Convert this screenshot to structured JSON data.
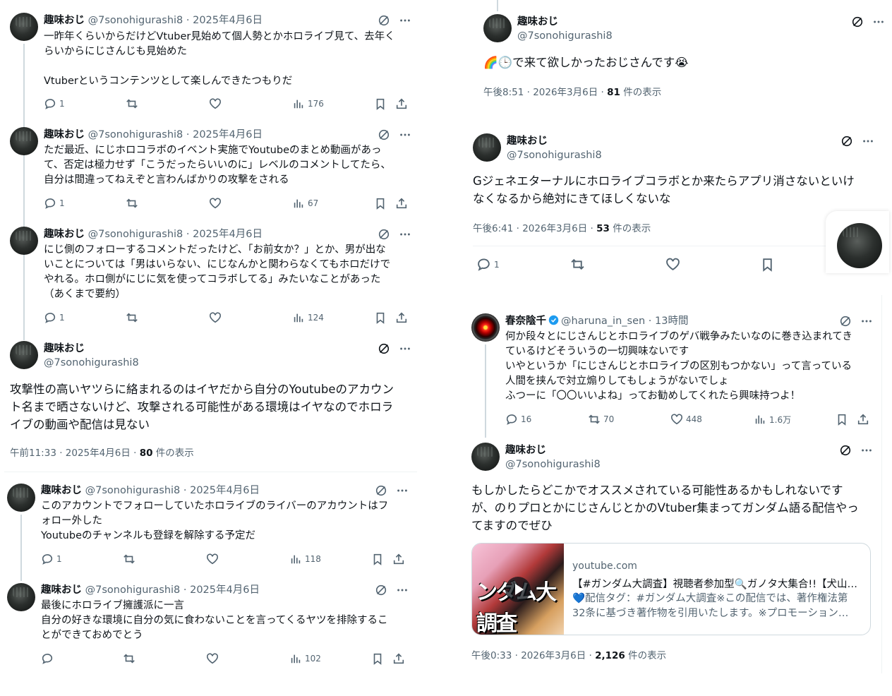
{
  "left_thread": {
    "tweets": [
      {
        "name": "趣味おじ",
        "handle": "@7sonohigurashi8",
        "date": "2025年4月6日",
        "text": "一昨年くらいからだけどVtuber見始めて個人勢とかホロライブ見て、去年く\nらいからにじさんじも見始めた\n\nVtuberというコンテンツとして楽しんできたつもりだ",
        "replies": "1",
        "retweets": "",
        "likes": "",
        "views": "176"
      },
      {
        "name": "趣味おじ",
        "handle": "@7sonohigurashi8",
        "date": "2025年4月6日",
        "text": "ただ最近、にじホロコラボのイベント実施でYoutubeのまとめ動画があっ\nて、否定は極力せず「こうだったらいいのに」レベルのコメントしてたら、\n自分は間違ってねえぞと言わんばかりの攻撃をされる",
        "replies": "1",
        "retweets": "",
        "likes": "",
        "views": "67"
      },
      {
        "name": "趣味おじ",
        "handle": "@7sonohigurashi8",
        "date": "2025年4月6日",
        "text": "にじ側のフォローするコメントだったけど、「お前女か？」とか、男が出な\nいことについては「男はいらない、にじなんかと関わらなくてもホロだけで\nやれる。ホロ側がにじに気を使ってコラボしてる」みたいなことがあった\n（あくまで要約）",
        "replies": "1",
        "retweets": "",
        "likes": "",
        "views": "124"
      }
    ],
    "main": {
      "name": "趣味おじ",
      "handle": "@7sonohigurashi8",
      "text": "攻撃性の高いヤツらに絡まれるのはイヤだから自分のYoutubeのアカウン\nト名まで晒さないけど、攻撃される可能性がある環境はイヤなのでホロラ\nイブの動画や配信は見ない",
      "time": "午前11:33 · 2025年4月6日 · ",
      "views": "80",
      "views_suffix": " 件の表示"
    },
    "replies": [
      {
        "name": "趣味おじ",
        "handle": "@7sonohigurashi8",
        "date": "2025年4月6日",
        "text": "このアカウントでフォローしていたホロライブのライバーのアカウントはフ\nォロー外した\nYoutubeのチャンネルも登録を解除する予定だ",
        "replies": "1",
        "retweets": "",
        "likes": "",
        "views": "118"
      },
      {
        "name": "趣味おじ",
        "handle": "@7sonohigurashi8",
        "date": "2025年4月6日",
        "text": "最後にホロライブ擁護派に一言\n自分の好きな環境に自分の気に食わないことを言ってくるヤツを排除するこ\nとができておめでとう",
        "replies": "",
        "retweets": "",
        "likes": "",
        "views": "102"
      }
    ]
  },
  "right_top": {
    "name": "趣味おじ",
    "handle": "@7sonohigurashi8",
    "text": "🌈🕒で来て欲しかったおじさんです😭",
    "time": "午後8:51 · 2026年3月6日 · ",
    "views": "81",
    "views_suffix": " 件の表示"
  },
  "right_mid": {
    "name": "趣味おじ",
    "handle": "@7sonohigurashi8",
    "text": "Gジェネエターナルにホロライブコラボとか来たらアプリ消さないといけ\nなくなるから絶対にきてほしくないな",
    "time": "午後6:41 · 2026年3月6日 · ",
    "views": "53",
    "views_suffix": " 件の表示",
    "replies": "1"
  },
  "right_bottom": {
    "parent": {
      "name": "春奈陰千",
      "handle": "@haruna_in_sen",
      "date": "13時間",
      "text": "何か段々とにじさんじとホロライブのゲバ戦争みたいなのに巻き込まれてき\nているけどそういうの一切興味ないです\nいやというか「にじさんじとホロライブの区別もつかない」って言っている\n人間を挟んで対立煽りしてもしょうがないでしょ\nふつーに「〇〇いいよね」ってお勧めしてくれたら興味持つよ！",
      "replies": "16",
      "retweets": "70",
      "likes": "448",
      "views": "1.6万"
    },
    "main": {
      "name": "趣味おじ",
      "handle": "@7sonohigurashi8",
      "text": "もしかしたらどこかでオススメされている可能性あるかもしれないです\nが、のりプロとかにじさんじとかのVtuber集まってガンダム語る配信やっ\nてますのでぜひ",
      "time": "午後0:33 · 2026年3月6日 · ",
      "views": "2,126",
      "views_suffix": " 件の表示"
    },
    "card": {
      "domain": "youtube.com",
      "title": "【#ガンダム大調査】視聴者参加型🔍ガノタ大集合!!【犬山…",
      "desc": "💙配信タグ：#ガンダム大調査※この配信では、著作権法第\n32条に基づき著作物を引用いたします。※プロモーション…",
      "thumb_text": "ンダム大調査"
    }
  }
}
